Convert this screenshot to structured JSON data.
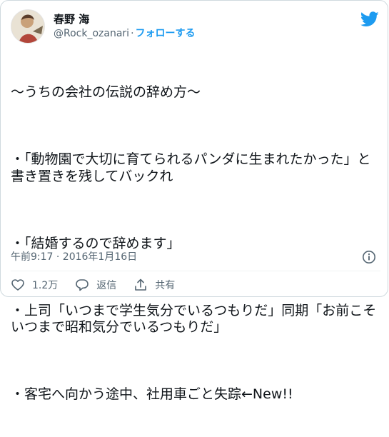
{
  "user": {
    "display_name": "春野 海",
    "handle": "@Rock_ozanari",
    "separator": "·",
    "follow_label": "フォローする"
  },
  "tweet": {
    "paragraphs": [
      "～うちの会社の伝説の辞め方～",
      "・「動物園で大切に育てられるパンダに生まれたかった」と書き置きを残してバックれ",
      "・「結婚するので辞めます」",
      "・上司「いつまで学生気分でいるつもりだ」同期「お前こそいつまで昭和気分でいるつもりだ」",
      "・客宅へ向かう途中、社用車ごと失踪←New!!"
    ],
    "timestamp": "午前9:17 · 2016年1月16日"
  },
  "actions": {
    "like_count": "1.2万",
    "reply_label": "返信",
    "share_label": "共有"
  },
  "icons": {
    "bird": "twitter-bird-icon",
    "info": "info-icon",
    "like": "heart-icon",
    "reply": "reply-bubble-icon",
    "share": "share-upload-icon"
  },
  "colors": {
    "accent": "#1d9bf0",
    "text": "#0f1419",
    "muted": "#536471",
    "border": "#cfd9de"
  }
}
